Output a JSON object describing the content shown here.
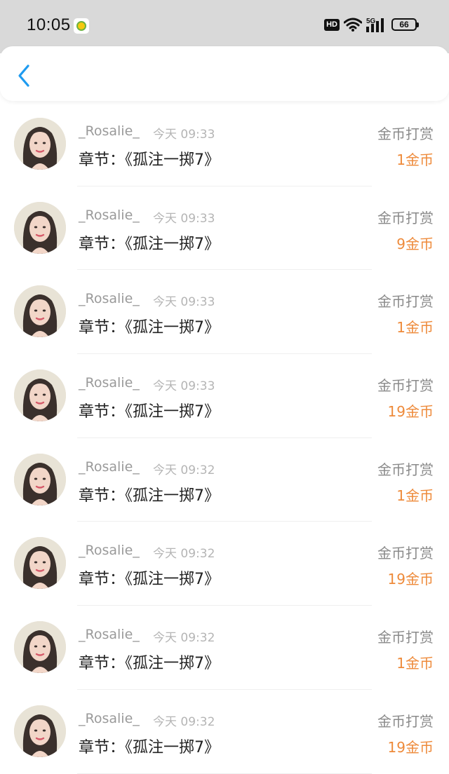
{
  "status_bar": {
    "time": "10:05",
    "hd_badge": "HD",
    "network": "5G",
    "battery": "66"
  },
  "header": {
    "back_icon": "chevron-left-icon",
    "back_color": "#1e9bf0"
  },
  "colors": {
    "amount": "#ee8a3a",
    "username": "#9a9a9a",
    "chapter": "#222222"
  },
  "items": [
    {
      "username": "_Rosalie_",
      "time": "今天 09:33",
      "chapter": "章节：《孤注一掷7》",
      "reward_type": "金币打赏",
      "amount": "1金币"
    },
    {
      "username": "_Rosalie_",
      "time": "今天 09:33",
      "chapter": "章节：《孤注一掷7》",
      "reward_type": "金币打赏",
      "amount": "9金币"
    },
    {
      "username": "_Rosalie_",
      "time": "今天 09:33",
      "chapter": "章节：《孤注一掷7》",
      "reward_type": "金币打赏",
      "amount": "1金币"
    },
    {
      "username": "_Rosalie_",
      "time": "今天 09:33",
      "chapter": "章节：《孤注一掷7》",
      "reward_type": "金币打赏",
      "amount": "19金币"
    },
    {
      "username": "_Rosalie_",
      "time": "今天 09:32",
      "chapter": "章节：《孤注一掷7》",
      "reward_type": "金币打赏",
      "amount": "1金币"
    },
    {
      "username": "_Rosalie_",
      "time": "今天 09:32",
      "chapter": "章节：《孤注一掷7》",
      "reward_type": "金币打赏",
      "amount": "19金币"
    },
    {
      "username": "_Rosalie_",
      "time": "今天 09:32",
      "chapter": "章节：《孤注一掷7》",
      "reward_type": "金币打赏",
      "amount": "1金币"
    },
    {
      "username": "_Rosalie_",
      "time": "今天 09:32",
      "chapter": "章节：《孤注一掷7》",
      "reward_type": "金币打赏",
      "amount": "19金币"
    }
  ]
}
